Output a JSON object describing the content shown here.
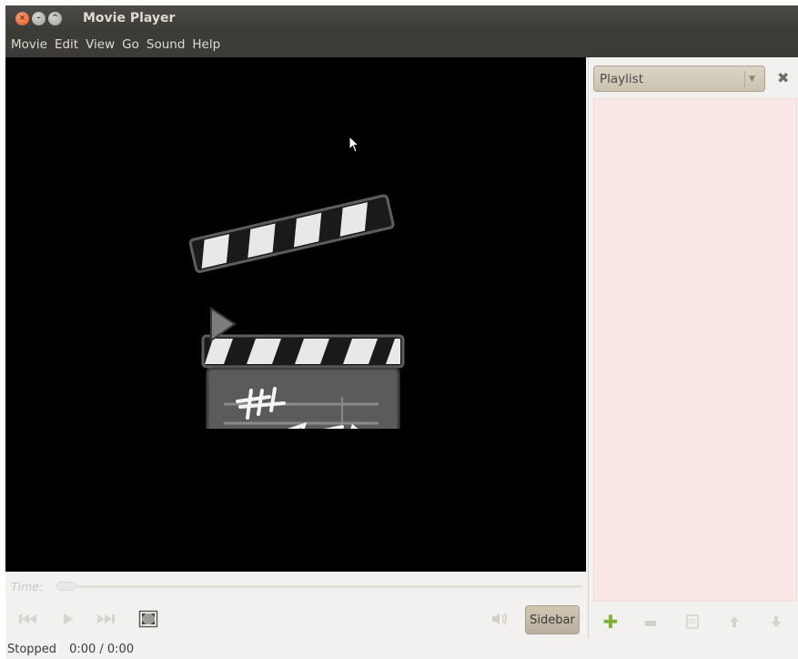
{
  "window": {
    "title": "Movie Player",
    "controls": {
      "close": "×",
      "minimize": "–",
      "maximize": "^"
    }
  },
  "menubar": {
    "items": [
      "Movie",
      "Edit",
      "View",
      "Go",
      "Sound",
      "Help"
    ]
  },
  "controls": {
    "time_label": "Time:",
    "seek_position": 0,
    "sidebar_button": "Sidebar"
  },
  "status": {
    "state": "Stopped",
    "time": "0:00 / 0:00"
  },
  "sidebar": {
    "selector_value": "Playlist",
    "arrow": "▼",
    "close": "✖",
    "add": "✚",
    "remove": "▬"
  },
  "colors": {
    "titlebar": "#3c3b37",
    "video_bg": "#000000",
    "playlist_bg": "#fbe7e5",
    "sidebar_button": "#c4bba9",
    "add_green": "#7fb03a"
  },
  "icons": {
    "video_placeholder": "clapperboard-icon",
    "cursor": "mouse-pointer-icon",
    "fullscreen": "fullscreen-icon",
    "volume": "volume-icon"
  }
}
